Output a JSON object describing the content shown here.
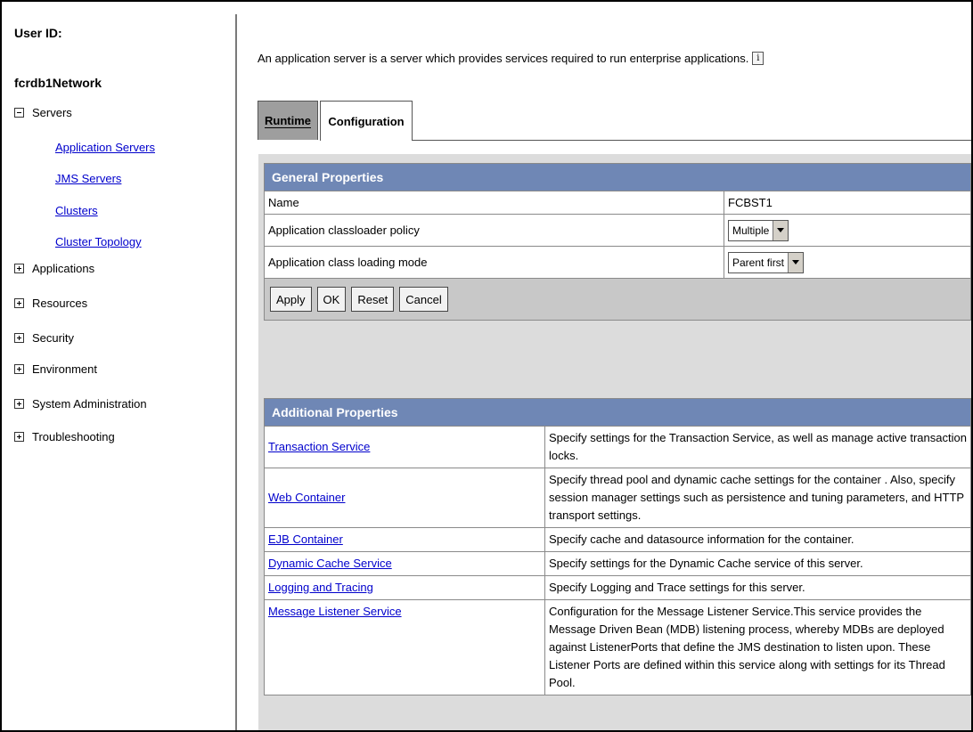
{
  "sidebar": {
    "user_id_label": "User ID:",
    "network": "fcrdb1Network",
    "servers": {
      "label": "Servers",
      "children": [
        "Application Servers",
        "JMS Servers",
        "Clusters",
        "Cluster Topology"
      ]
    },
    "nodes": [
      "Applications",
      "Resources",
      "Security",
      "Environment",
      "System Administration",
      "Troubleshooting"
    ]
  },
  "main": {
    "intro": "An application server is a server which provides services required to run enterprise applications.",
    "info_icon_text": "i",
    "tabs": [
      {
        "label": "Runtime",
        "active": false
      },
      {
        "label": "Configuration",
        "active": true
      }
    ],
    "general": {
      "header": "General Properties",
      "name_label": "Name",
      "name_value": "FCBST1",
      "classloader_label": "Application classloader policy",
      "classloader_value": "Multiple",
      "loading_label": "Application class loading mode",
      "loading_value": "Parent first",
      "buttons": {
        "apply": "Apply",
        "ok": "OK",
        "reset": "Reset",
        "cancel": "Cancel"
      }
    },
    "additional": {
      "header": "Additional Properties",
      "rows": [
        {
          "link": "Transaction Service",
          "desc": "Specify settings for the Transaction Service, as well as manage active transaction locks."
        },
        {
          "link": "Web Container",
          "desc": "Specify thread pool and dynamic cache settings for the container . Also, specify session manager settings such as persistence and tuning parameters, and HTTP transport settings."
        },
        {
          "link": "EJB Container",
          "desc": "Specify cache and datasource information for the container."
        },
        {
          "link": "Dynamic Cache Service",
          "desc": "Specify settings for the Dynamic Cache service of this server."
        },
        {
          "link": "Logging and Tracing",
          "desc": "Specify Logging and Trace settings for this server."
        },
        {
          "link": "Message Listener Service",
          "desc": "Configuration for the Message Listener Service.This service provides the Message Driven Bean (MDB) listening process, whereby MDBs are deployed against ListenerPorts that define the JMS destination to listen upon. These Listener Ports are defined within this service along with settings for its Thread Pool."
        }
      ]
    }
  },
  "colors": {
    "header_bg": "#6f87b5",
    "link": "#0000cc",
    "panel_bg": "#dcdcdc"
  }
}
